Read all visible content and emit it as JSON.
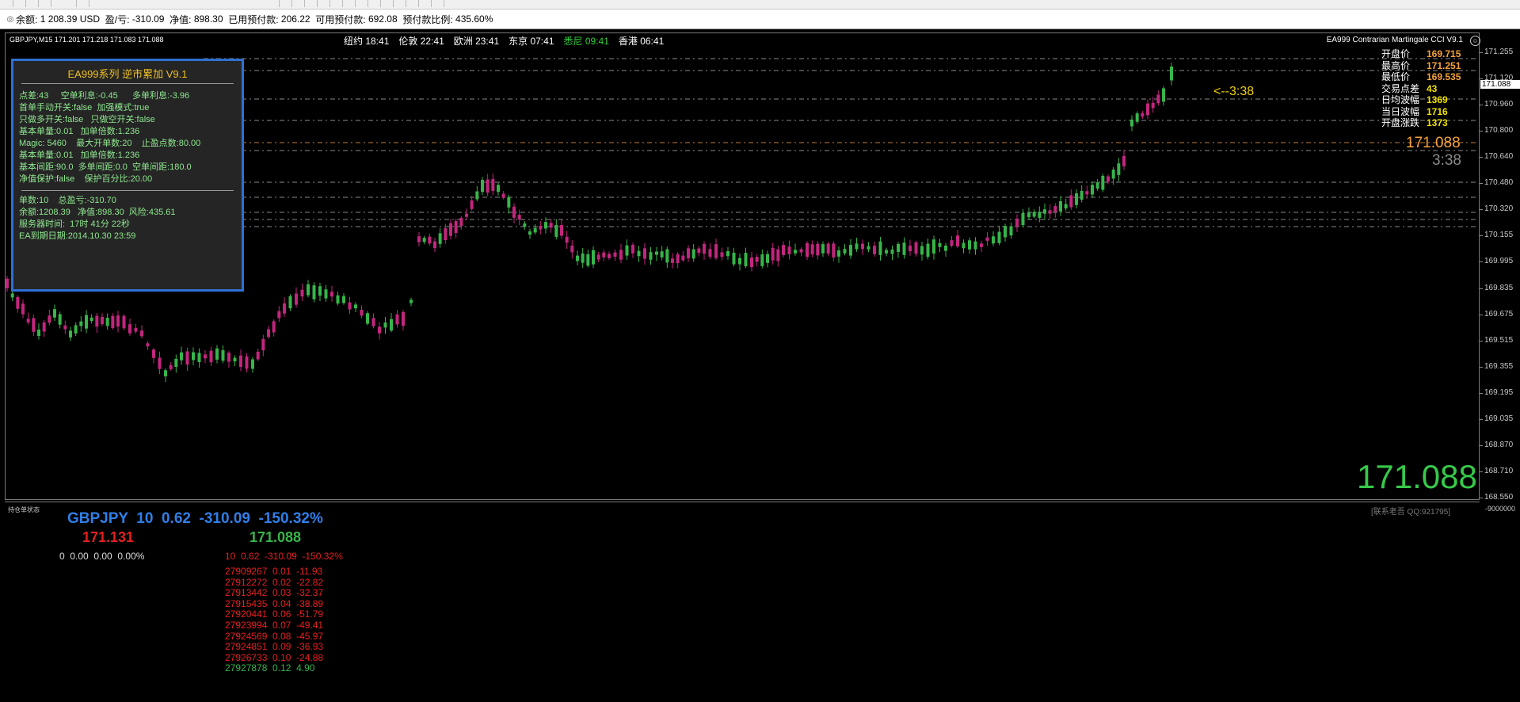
{
  "account_bar": {
    "balance_label": "余额:",
    "balance_value": "1 208.39 USD",
    "pl_label": "盈/亏:",
    "pl_value": "-310.09",
    "equity_label": "净值:",
    "equity_value": "898.30",
    "used_margin_label": "已用预付款:",
    "used_margin_value": "206.22",
    "free_margin_label": "可用预付款:",
    "free_margin_value": "692.08",
    "margin_level_label": "预付款比例:",
    "margin_level_value": "435.60%"
  },
  "chart": {
    "symbol_title": "GBPJPY,M15  171.201 171.218 171.083 171.088",
    "ea_name": "EA999 Contrarian Martingale CCI V9.1",
    "sessions": [
      {
        "name": "纽约",
        "time": "18:41",
        "highlight": false
      },
      {
        "name": "伦敦",
        "time": "22:41",
        "highlight": false
      },
      {
        "name": "欧洲",
        "time": "23:41",
        "highlight": false
      },
      {
        "name": "东京",
        "time": "07:41",
        "highlight": false
      },
      {
        "name": "悉尼",
        "time": "09:41",
        "highlight": true
      },
      {
        "name": "香港",
        "time": "06:41",
        "highlight": false
      }
    ],
    "price_axis": [
      "171.255",
      "171.120",
      "170.960",
      "170.800",
      "170.640",
      "170.480",
      "170.320",
      "170.155",
      "169.995",
      "169.835",
      "169.675",
      "169.515",
      "169.355",
      "169.195",
      "169.035",
      "168.870",
      "168.710",
      "168.550"
    ],
    "current_price_tag": "171.088",
    "sub_axis_label": "-9000000",
    "colors": {
      "bull": "#37b54a",
      "bear": "#c2267e",
      "grid": "#8a8a8a",
      "panel_border": "#2f6fd1"
    }
  },
  "ea_panel": {
    "title": "EA999系列    逆市累加 V9.1",
    "lines_a": [
      "点差:43     空单利息:-0.45      多单利息:-3.96",
      "首单手动开关:false  加强模式:true",
      "只做多开关:false   只做空开关:false",
      "基本单量:0.01   加单倍数:1.236",
      "Magic: 5460    最大开单数:20    止盈点数:80.00",
      "基本单量:0.01   加单倍数:1.236",
      "基本间距:90.0  多单间距:0.0  空单间距:180.0",
      "净值保护:false    保护百分比:20.00"
    ],
    "lines_b": [
      "单数:10    总盈亏:-310.70",
      "余额:1208.39   净值:898.30  风险:435.61",
      "服务器时间:  17时 41分 22秒",
      "EA到期日期:2014.10.30 23:59"
    ]
  },
  "stats": {
    "rows": [
      {
        "label": "开盘价",
        "value": "169.715",
        "color": "#f6a23a"
      },
      {
        "label": "最高价",
        "value": "171.251",
        "color": "#f6a23a"
      },
      {
        "label": "最低价",
        "value": "169.535",
        "color": "#f6a23a"
      },
      {
        "label": "交易点差",
        "value": "43",
        "color": "#f0e000"
      },
      {
        "label": "日均波幅",
        "value": "1369",
        "color": "#f0e000"
      },
      {
        "label": "当日波幅",
        "value": "1716",
        "color": "#f0e000"
      },
      {
        "label": "开盘涨跌",
        "value": "1373",
        "color": "#f0e000"
      }
    ],
    "timer_arrow": "<--3:38",
    "orange_price": "171.088",
    "grey_timer": "3:38",
    "big_price": "171.088"
  },
  "subwindow": {
    "title": "持仓单状态",
    "qq_tag": "[联系老吾 QQ:921795]",
    "headline": "GBPJPY  10  0.62  -310.09  -150.32%",
    "bid": "171.131",
    "ask": "171.088",
    "zero_line": "0  0.00  0.00  0.00%",
    "sum_line": "10  0.62  -310.09  -150.32%",
    "orders": [
      {
        "text": "27909267  0.01  -11.93",
        "profit": false
      },
      {
        "text": "27912272  0.02  -22.82",
        "profit": false
      },
      {
        "text": "27913442  0.03  -32.37",
        "profit": false
      },
      {
        "text": "27915435  0.04  -38.89",
        "profit": false
      },
      {
        "text": "27920441  0.06  -51.79",
        "profit": false
      },
      {
        "text": "27923994  0.07  -49.41",
        "profit": false
      },
      {
        "text": "27924569  0.08  -45.97",
        "profit": false
      },
      {
        "text": "27924851  0.09  -36.93",
        "profit": false
      },
      {
        "text": "27926733  0.10  -24.88",
        "profit": false
      },
      {
        "text": "27927878  0.12  4.90",
        "profit": true
      }
    ]
  }
}
